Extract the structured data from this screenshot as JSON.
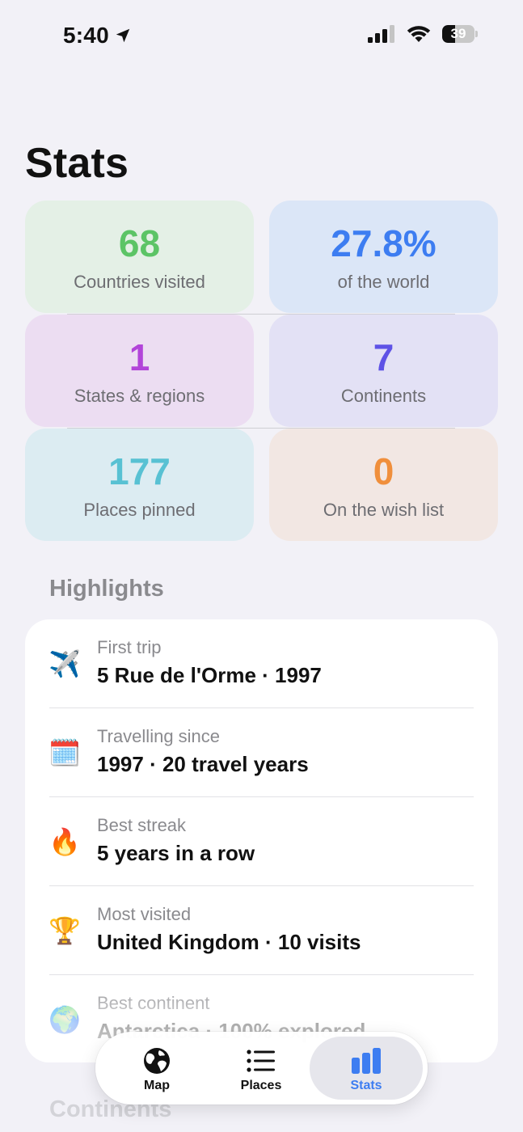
{
  "status_bar": {
    "time": "5:40",
    "battery": "39",
    "battery_level": 0.39
  },
  "page": {
    "title": "Stats"
  },
  "stats": [
    {
      "value": "68",
      "label": "Countries visited",
      "color": "#5cc466",
      "bg": "#e4f0e6"
    },
    {
      "value": "27.8%",
      "label": "of the world",
      "color": "#3d7df1",
      "bg": "#dbe6f7"
    },
    {
      "value": "1",
      "label": "States & regions",
      "color": "#b244d9",
      "bg": "#ecddf2"
    },
    {
      "value": "7",
      "label": "Continents",
      "color": "#5e52e6",
      "bg": "#e3e1f5"
    },
    {
      "value": "177",
      "label": "Places pinned",
      "color": "#58c1d3",
      "bg": "#dcecf2"
    },
    {
      "value": "0",
      "label": "On the wish list",
      "color": "#f08f3c",
      "bg": "#f2e7e3"
    }
  ],
  "highlights": {
    "title": "Highlights",
    "items": [
      {
        "icon": "airplane-icon",
        "glyph": "✈️",
        "label": "First trip",
        "value": "5 Rue de l'Orme · 1997"
      },
      {
        "icon": "calendar-icon",
        "glyph": "🗓️",
        "label": "Travelling since",
        "value": "1997 · 20 travel years"
      },
      {
        "icon": "fire-icon",
        "glyph": "🔥",
        "label": "Best streak",
        "value": "5 years in a row"
      },
      {
        "icon": "trophy-icon",
        "glyph": "🏆",
        "label": "Most visited",
        "value": "United Kingdom · 10 visits"
      },
      {
        "icon": "globe-icon",
        "glyph": "🌍",
        "label": "Best continent",
        "value": "Antarctica · 100% explored"
      }
    ]
  },
  "next_section": {
    "title": "Continents"
  },
  "tab_bar": {
    "tabs": [
      {
        "label": "Map",
        "icon": "globe-icon",
        "active": false
      },
      {
        "label": "Places",
        "icon": "list-icon",
        "active": false
      },
      {
        "label": "Stats",
        "icon": "bar-chart-icon",
        "active": true
      }
    ],
    "active_color": "#3d7df1"
  }
}
